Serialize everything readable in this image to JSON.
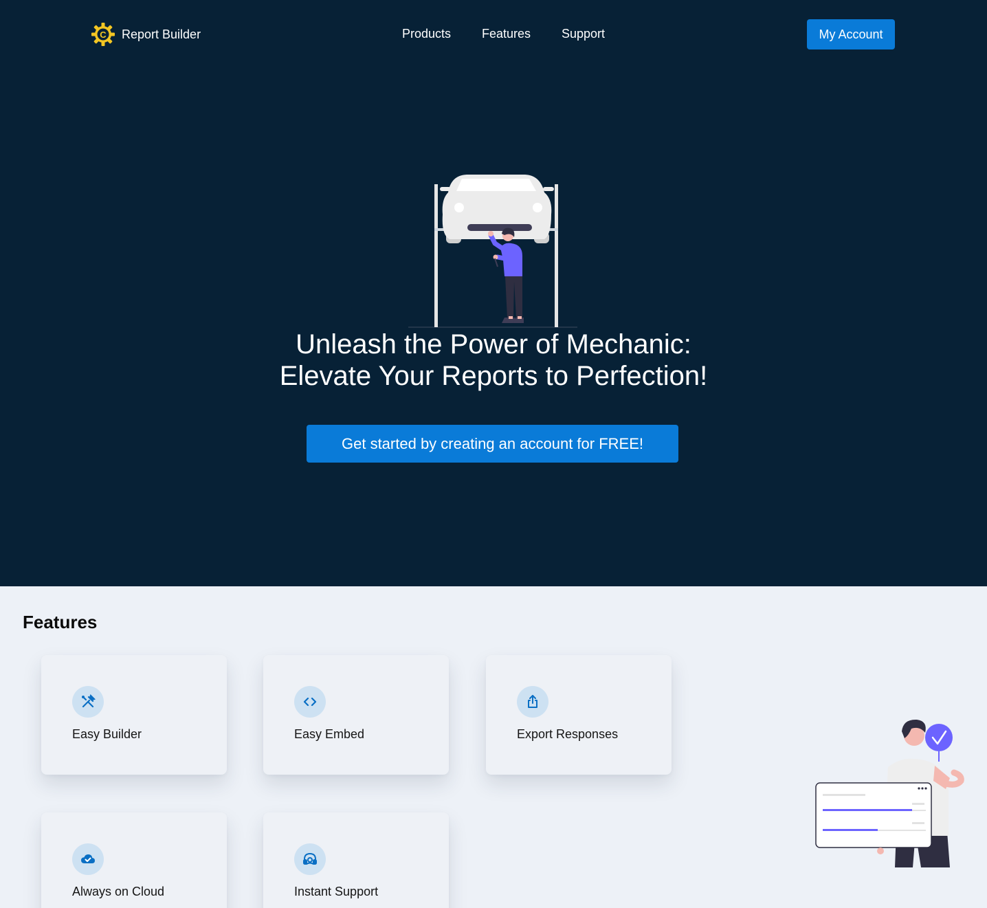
{
  "nav": {
    "brand_name": "Report Builder",
    "logo_icon": "gear-c-logo-icon",
    "links": [
      {
        "label": "Products"
      },
      {
        "label": "Features"
      },
      {
        "label": "Support"
      }
    ],
    "account_button": "My Account"
  },
  "hero": {
    "title_line1": "Unleash the Power of Mechanic:",
    "title_line2": "Elevate Your Reports to Perfection!",
    "cta_label": "Get started by creating an account for FREE!",
    "illustration": "mechanic-under-car-illustration"
  },
  "features": {
    "heading": "Features",
    "items": [
      {
        "label": "Easy Builder",
        "icon": "tools-icon"
      },
      {
        "label": "Easy Embed",
        "icon": "code-icon"
      },
      {
        "label": "Export Responses",
        "icon": "share-export-icon"
      },
      {
        "label": "Always on Cloud",
        "icon": "cloud-check-icon"
      },
      {
        "label": "Instant Support",
        "icon": "headset-icon"
      }
    ],
    "illustration": "person-with-checkmark-illustration"
  },
  "colors": {
    "hero_background": "#072136",
    "accent": "#0a7bd8",
    "page_background": "#edf1f7",
    "icon_circle": "#cde1f2",
    "logo_yellow": "#f3c623",
    "illustration_purple": "#6c63ff"
  }
}
